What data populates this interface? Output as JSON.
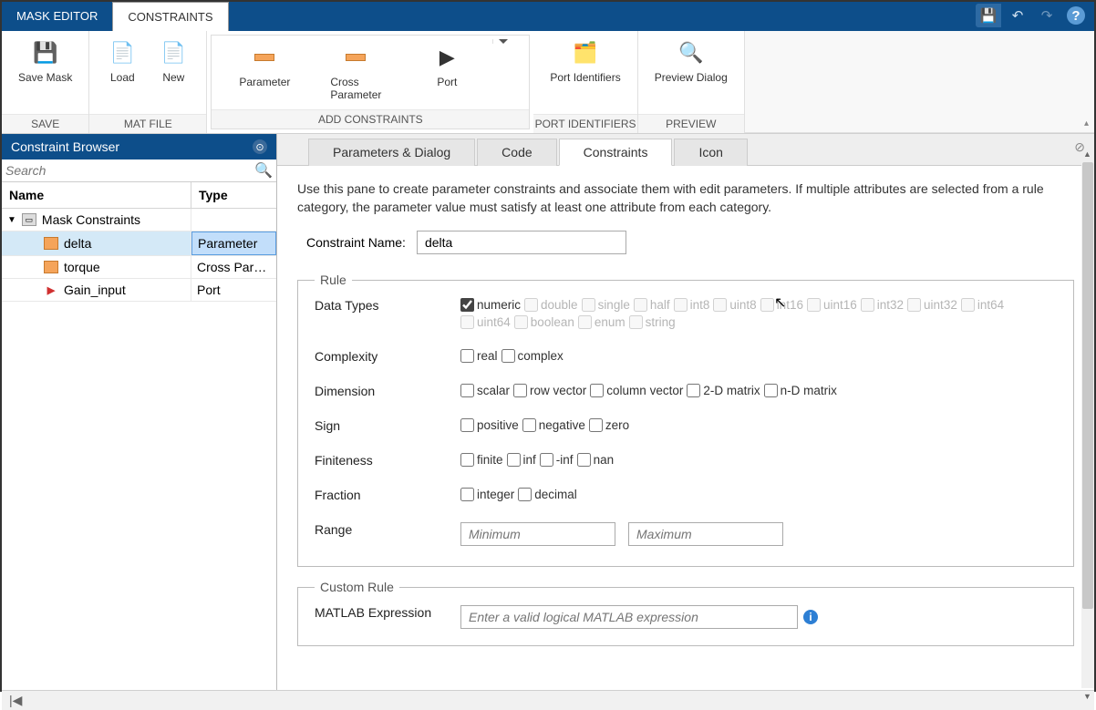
{
  "topbar": {
    "tabs": [
      "MASK EDITOR",
      "CONSTRAINTS"
    ],
    "active": 1
  },
  "ribbon": {
    "groups": [
      {
        "label": "SAVE",
        "items": [
          {
            "text": "Save Mask"
          }
        ]
      },
      {
        "label": "MAT FILE",
        "items": [
          {
            "text": "Load"
          },
          {
            "text": "New"
          }
        ]
      },
      {
        "label": "ADD CONSTRAINTS",
        "items": [
          {
            "text": "Parameter"
          },
          {
            "text": "Cross\nParameter"
          },
          {
            "text": "Port"
          }
        ]
      },
      {
        "label": "PORT IDENTIFIERS",
        "items": [
          {
            "text": "Port Identifiers"
          }
        ]
      },
      {
        "label": "PREVIEW",
        "items": [
          {
            "text": "Preview Dialog"
          }
        ]
      }
    ]
  },
  "browser": {
    "title": "Constraint Browser",
    "search_placeholder": "Search",
    "headers": {
      "name": "Name",
      "type": "Type"
    },
    "root": "Mask Constraints",
    "rows": [
      {
        "name": "delta",
        "type": "Parameter",
        "selected": true,
        "icon": "param"
      },
      {
        "name": "torque",
        "type": "Cross Par…",
        "icon": "param"
      },
      {
        "name": "Gain_input",
        "type": "Port",
        "icon": "port"
      }
    ]
  },
  "tabs": {
    "items": [
      "Parameters & Dialog",
      "Code",
      "Constraints",
      "Icon"
    ],
    "active": 2
  },
  "pane": {
    "description": "Use this pane to create parameter constraints and associate them with edit parameters. If multiple attributes are selected from a rule category, the parameter value must satisfy at least one attribute from each category.",
    "name_label": "Constraint Name:",
    "name_value": "delta",
    "rule_legend": "Rule",
    "rows": {
      "data_types": {
        "label": "Data Types",
        "opts": [
          {
            "t": "numeric",
            "checked": true,
            "disabled": false
          },
          {
            "t": "double",
            "disabled": true
          },
          {
            "t": "single",
            "disabled": true
          },
          {
            "t": "half",
            "disabled": true
          },
          {
            "t": "int8",
            "disabled": true
          },
          {
            "t": "uint8",
            "disabled": true
          },
          {
            "t": "int16",
            "disabled": true
          },
          {
            "t": "uint16",
            "disabled": true
          },
          {
            "t": "int32",
            "disabled": true
          },
          {
            "t": "uint32",
            "disabled": true
          },
          {
            "t": "int64",
            "disabled": true
          },
          {
            "t": "uint64",
            "disabled": true
          },
          {
            "t": "boolean",
            "disabled": true
          },
          {
            "t": "enum",
            "disabled": true
          },
          {
            "t": "string",
            "disabled": true
          }
        ]
      },
      "complexity": {
        "label": "Complexity",
        "opts": [
          "real",
          "complex"
        ]
      },
      "dimension": {
        "label": "Dimension",
        "opts": [
          "scalar",
          "row vector",
          "column vector",
          "2-D matrix",
          "n-D matrix"
        ]
      },
      "sign": {
        "label": "Sign",
        "opts": [
          "positive",
          "negative",
          "zero"
        ]
      },
      "finiteness": {
        "label": "Finiteness",
        "opts": [
          "finite",
          "inf",
          "-inf",
          "nan"
        ]
      },
      "fraction": {
        "label": "Fraction",
        "opts": [
          "integer",
          "decimal"
        ]
      },
      "range": {
        "label": "Range",
        "min_ph": "Minimum",
        "max_ph": "Maximum"
      }
    },
    "custom_legend": "Custom Rule",
    "custom_expr_label": "MATLAB Expression",
    "custom_expr_ph": "Enter a valid logical MATLAB expression"
  }
}
